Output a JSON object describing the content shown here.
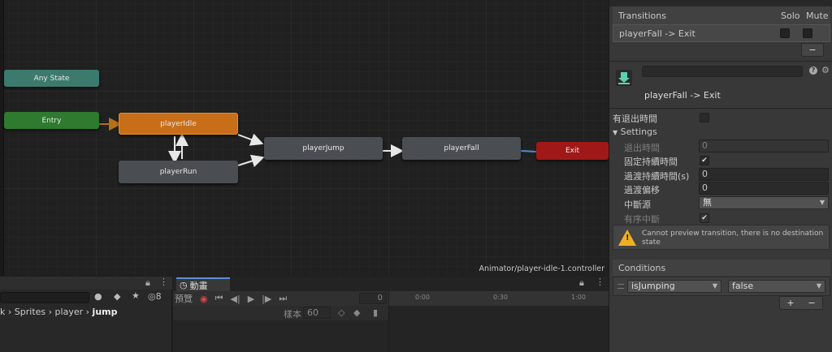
{
  "graph": {
    "nodes": {
      "any_state": "Any State",
      "entry": "Entry",
      "idle": "playerIdle",
      "run": "playerRun",
      "jump": "playerJump",
      "fall": "playerFall",
      "exit": "Exit"
    },
    "path": "Animator/player-idle-1.controller",
    "colors": {
      "any_state": "#3d7a6e",
      "entry": "#2e7a2e",
      "default_state": "#c86e18",
      "state": "#4a4d52",
      "exit": "#a01818",
      "selected_transition": "#4a8fd6"
    }
  },
  "inspector": {
    "transitions_header": "Transitions",
    "solo_label": "Solo",
    "mute_label": "Mute",
    "transition_row": "playerFall -> Exit",
    "remove_button": "−",
    "transition_title": "playerFall -> Exit",
    "has_exit_time": "有退出時間",
    "settings_label": "Settings",
    "exit_time_label": "退出時間",
    "exit_time_value": "0",
    "fixed_duration_label": "固定持續時間",
    "fixed_duration_checked": true,
    "transition_duration_label": "過渡持續時間(s)",
    "transition_duration_value": "0",
    "transition_offset_label": "過渡偏移",
    "transition_offset_value": "0",
    "interruption_source_label": "中斷源",
    "interruption_source_value": "無",
    "ordered_interruption_label": "有序中斷",
    "warning_text": "Cannot preview transition, there is no destination state",
    "conditions_header": "Conditions",
    "condition_param": "isJumping",
    "condition_value": "false",
    "add_button": "+",
    "minus_button": "−"
  },
  "project": {
    "count": "8",
    "breadcrumb": [
      "k",
      "Sprites",
      "player",
      "jump"
    ]
  },
  "animation": {
    "tab_label": "動畫",
    "preview_label": "預覽",
    "frame_value": "0",
    "samples_label": "樣本",
    "samples_value": "60",
    "timeline_ticks": [
      "0:00",
      "0:30",
      "1:00"
    ]
  }
}
